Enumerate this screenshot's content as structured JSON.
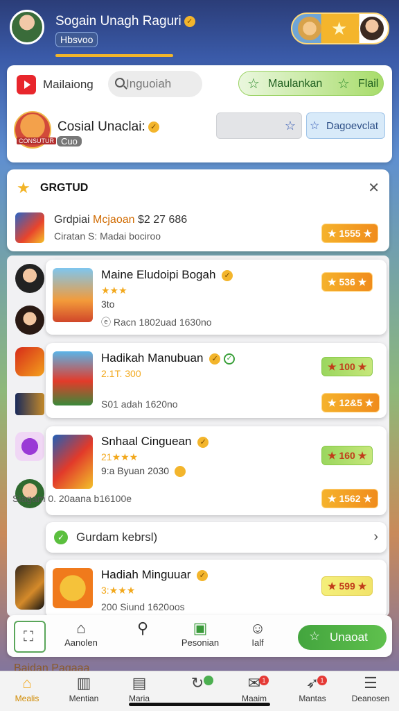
{
  "header": {
    "username": "Sogain Unagh Raguri",
    "sub_label": "Hbsvoo"
  },
  "search": {
    "label": "Mailaiong",
    "placeholder": "Inguoiah",
    "pill_label": "Maulankan",
    "pill_label2": "Flail"
  },
  "profile": {
    "avatar_tag": "CONSUTUR",
    "name": "Cosial Unaclai:",
    "chip": "Cuo",
    "blue_btn": "Dagoevclat"
  },
  "notice": {
    "title": "GRGTUD",
    "line1_prefix": "Grdpiai",
    "line1_highlight": "Mcjaoan",
    "line1_suffix": "$2 27 686",
    "line2": "Ciratan S: Madai bociroo",
    "badge": "1555"
  },
  "items": [
    {
      "title": "Maine Eludoipi Bogah",
      "stars": "★★★",
      "sub": "3to",
      "meta": "ⓔ Racn  1802uad 1630no",
      "badge": "536"
    },
    {
      "title": "Hadikah Manubuan",
      "stars": "",
      "sub": "2.1T. 300",
      "meta": "S01 adah 1620no",
      "badge_top": "100",
      "badge": "12&5"
    },
    {
      "title": "Snhaal Cinguean",
      "stars": "21★★★",
      "sub": "9:a Byuan 2030",
      "meta": "Siagam  0. 20aana b16100e",
      "badge_top": "160",
      "badge": "1562"
    },
    {
      "title": "Hadiah Minguuar",
      "stars": "3:★★★",
      "sub": "",
      "meta": "200 Siund 1620oos",
      "badge": "599"
    }
  ],
  "expand": {
    "label": "Gurdam kebrsl)"
  },
  "bottom_actions": {
    "a1": "Aanolen",
    "a3": "Pesonian",
    "a4": "Ialf",
    "cta": "Unaoat"
  },
  "peek": {
    "text": "Baidan Pagaaa"
  },
  "tabs": [
    {
      "label": "Mealis"
    },
    {
      "label": "Mentian"
    },
    {
      "label": "Maria"
    },
    {
      "label": ""
    },
    {
      "label": "Maaim"
    },
    {
      "label": "Mantas"
    },
    {
      "label": "Deanosen"
    }
  ],
  "colors": {
    "accent_orange": "#f2a81c",
    "accent_green": "#43a53e",
    "youtube_red": "#e8262c"
  }
}
